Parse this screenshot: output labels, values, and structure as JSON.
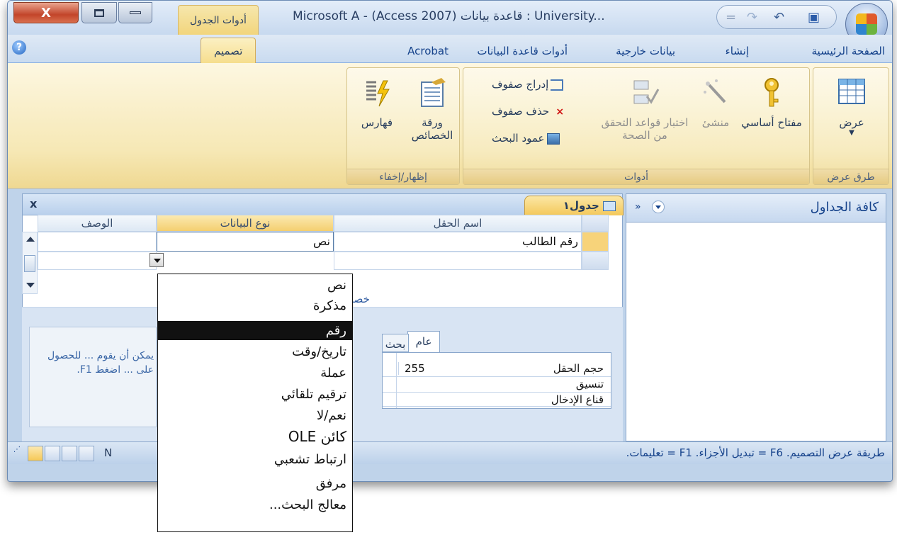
{
  "window": {
    "app_title": "Microsoft A - (Access 2007) قاعدة بيانات : University...",
    "context_tab": "أدوات الجدول",
    "close_glyph": "X",
    "qat_divider": "="
  },
  "tabs": [
    "الصفحة الرئيسية",
    "إنشاء",
    "بيانات خارجية",
    "أدوات قاعدة البيانات",
    "Acrobat",
    "تصميم"
  ],
  "ribbon": {
    "views_group": {
      "label": "طرق عرض",
      "view_button": "عرض"
    },
    "tools_group": {
      "label": "أدوات",
      "primary_key": "مفتاح أساسي",
      "builder": "منشئ",
      "test_validation": "اختبار قواعد التحقق من الصحة",
      "insert_rows": "إدراج صفوف",
      "delete_rows": "حذف صفوف",
      "lookup_column": "عمود البحث"
    },
    "showhide_group": {
      "label": "إظهار/إخفاء",
      "property_sheet": "ورقة الخصائص",
      "indexes": "فهارس"
    }
  },
  "document": {
    "close_glyph": "x",
    "tab_title": "جدول١",
    "columns": {
      "field_name": "اسم الحقل",
      "data_type": "نوع البيانات",
      "description": "الوصف"
    },
    "rows": [
      {
        "field_name": "رقم الطالب",
        "data_type": "نص",
        "description": ""
      }
    ],
    "field_props_label": "خصا"
  },
  "properties": {
    "tabs": {
      "general": "عام",
      "lookup": "بحث"
    },
    "rows": [
      {
        "name": "حجم الحقل",
        "value": "255"
      },
      {
        "name": "تنسيق",
        "value": ""
      },
      {
        "name": "قناع الإدخال",
        "value": ""
      }
    ],
    "help_text": "يمكن أن يقوم ... للحصول على ... اضغط F1."
  },
  "nav_pane": {
    "title": "كافة الجداول",
    "chevron": "»"
  },
  "statusbar": {
    "text": "طريقة عرض التصميم. F6 = تبديل الأجزاء. F1 = تعليمات.",
    "fragment": "N"
  },
  "data_type_dropdown": {
    "items": [
      "نص",
      "مذكرة",
      "رقم",
      "تاريخ/وقت",
      "عملة",
      "ترقيم تلقائي",
      "نعم/لا",
      "كائن OLE",
      "ارتباط تشعبي",
      "مرفق",
      "معالج البحث..."
    ],
    "selected": "رقم"
  }
}
